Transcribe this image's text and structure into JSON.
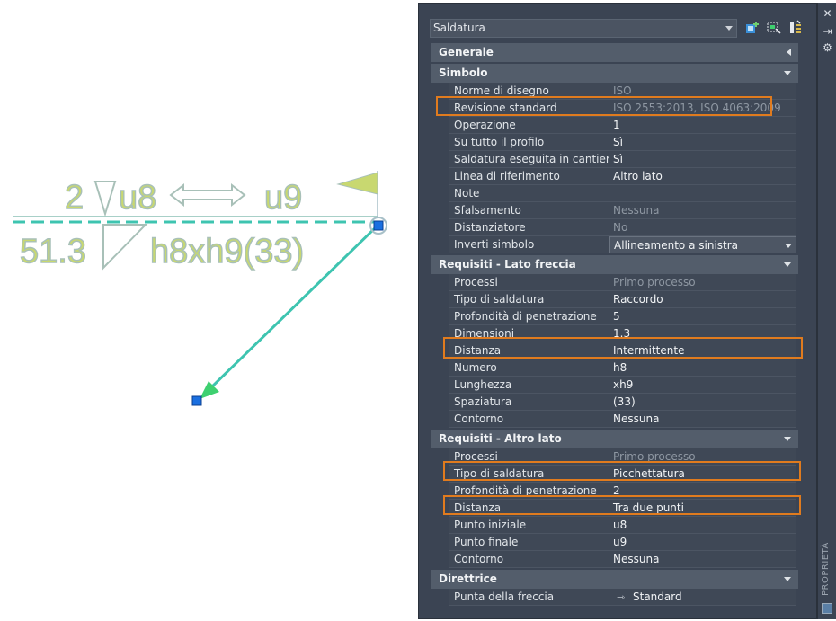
{
  "drawing": {
    "weld_top_qty": "2",
    "weld_top_text": "u8",
    "weld_top_end": "u9",
    "weld_bottom_size": "51.3",
    "weld_bottom_text": "h8xh9(33)"
  },
  "palette": {
    "object_type": "Saldatura",
    "strip_label": "PROPRIETÀ"
  },
  "sections": {
    "generale": {
      "title": "Generale"
    },
    "simbolo": {
      "title": "Simbolo",
      "rows": [
        {
          "name": "Norme di disegno",
          "value": "ISO"
        },
        {
          "name": "Revisione standard",
          "value": "ISO 2553:2013, ISO 4063:2009"
        },
        {
          "name": "Operazione",
          "value": "1"
        },
        {
          "name": "Su tutto il profilo",
          "value": "Sì"
        },
        {
          "name": "Saldatura eseguita in cantiere",
          "value": "Sì"
        },
        {
          "name": "Linea di riferimento",
          "value": "Altro lato"
        },
        {
          "name": "Note",
          "value": ""
        },
        {
          "name": "Sfalsamento",
          "value": "Nessuna"
        },
        {
          "name": "Distanziatore",
          "value": "No"
        },
        {
          "name": "Inverti simbolo",
          "value": "Allineamento a sinistra"
        }
      ]
    },
    "lato_freccia": {
      "title": "Requisiti - Lato freccia",
      "rows": [
        {
          "name": "Processi",
          "value": "Primo processo"
        },
        {
          "name": "Tipo di saldatura",
          "value": "Raccordo"
        },
        {
          "name": "Profondità di penetrazione",
          "value": "5"
        },
        {
          "name": "Dimensioni",
          "value": "1.3"
        },
        {
          "name": "Distanza",
          "value": "Intermittente"
        },
        {
          "name": "Numero",
          "value": "h8"
        },
        {
          "name": "Lunghezza",
          "value": "xh9"
        },
        {
          "name": "Spaziatura",
          "value": "(33)"
        },
        {
          "name": "Contorno",
          "value": "Nessuna"
        }
      ]
    },
    "altro_lato": {
      "title": "Requisiti - Altro lato",
      "rows": [
        {
          "name": "Processi",
          "value": "Primo processo"
        },
        {
          "name": "Tipo di saldatura",
          "value": "Picchettatura"
        },
        {
          "name": "Profondità di penetrazione",
          "value": "2"
        },
        {
          "name": "Distanza",
          "value": "Tra due punti"
        },
        {
          "name": "Punto iniziale",
          "value": "u8"
        },
        {
          "name": "Punto finale",
          "value": "u9"
        },
        {
          "name": "Contorno",
          "value": "Nessuna"
        }
      ]
    },
    "direttrice": {
      "title": "Direttrice",
      "rows": [
        {
          "name": "Punta della freccia",
          "value": "Standard"
        }
      ]
    }
  },
  "colors": {
    "highlight": "#e07b1e",
    "weld_fill": "#c8d870",
    "leader": "#3ec4b0",
    "grip": "#1a6fe0"
  }
}
